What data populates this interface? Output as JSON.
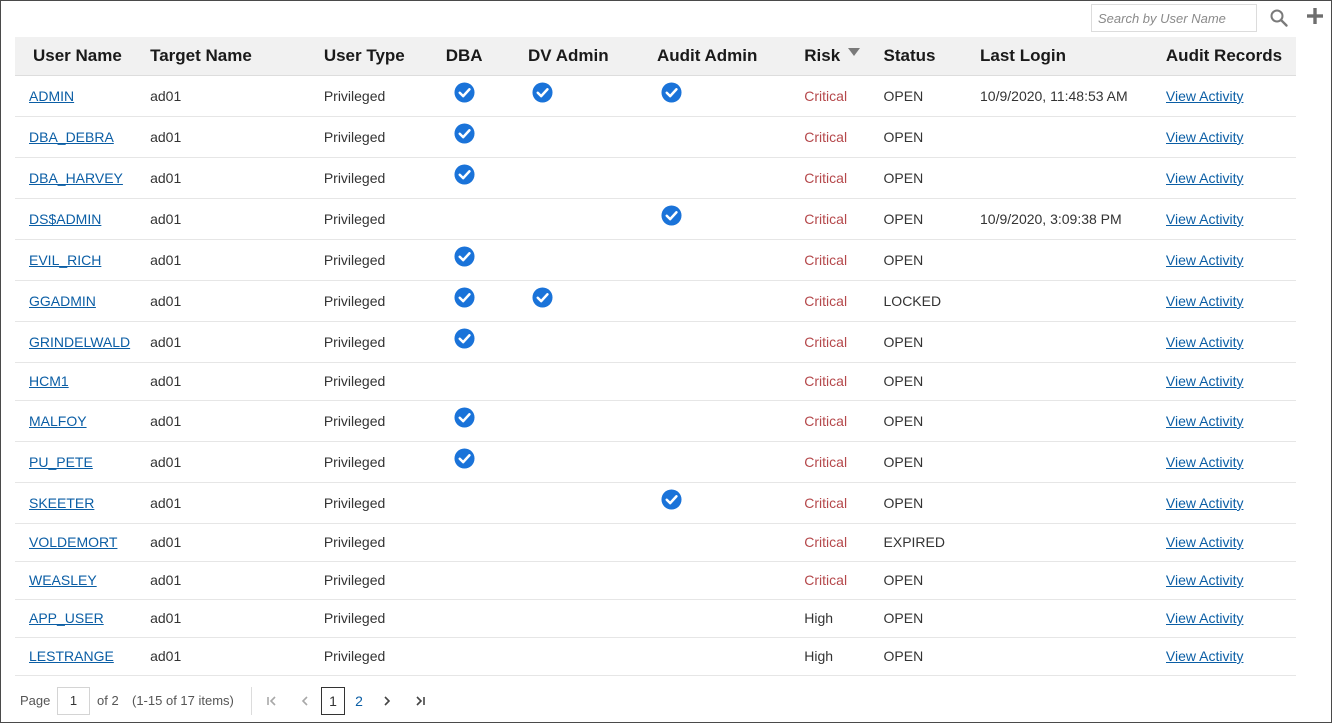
{
  "toolbar": {
    "search_placeholder": "Search by User Name",
    "search_icon": "search-icon",
    "add_icon": "plus-icon"
  },
  "colors": {
    "link": "#0b5ea5",
    "check": "#1a73d9",
    "critical": "#b5484b",
    "header_bg": "#f1f1f1"
  },
  "table": {
    "columns": [
      "User Name",
      "Target Name",
      "User Type",
      "DBA",
      "DV Admin",
      "Audit Admin",
      "Risk",
      "Status",
      "Last Login",
      "Audit Records"
    ],
    "sorted_column": "Risk",
    "sort_direction": "descending",
    "rows": [
      {
        "user": "ADMIN",
        "target": "ad01",
        "type": "Privileged",
        "dba": true,
        "dv_admin": true,
        "audit_admin": true,
        "risk": "Critical",
        "status": "OPEN",
        "last_login": "10/9/2020, 11:48:53 AM",
        "audit": "View Activity"
      },
      {
        "user": "DBA_DEBRA",
        "target": "ad01",
        "type": "Privileged",
        "dba": true,
        "dv_admin": false,
        "audit_admin": false,
        "risk": "Critical",
        "status": "OPEN",
        "last_login": "",
        "audit": "View Activity"
      },
      {
        "user": "DBA_HARVEY",
        "target": "ad01",
        "type": "Privileged",
        "dba": true,
        "dv_admin": false,
        "audit_admin": false,
        "risk": "Critical",
        "status": "OPEN",
        "last_login": "",
        "audit": "View Activity"
      },
      {
        "user": "DS$ADMIN",
        "target": "ad01",
        "type": "Privileged",
        "dba": false,
        "dv_admin": false,
        "audit_admin": true,
        "risk": "Critical",
        "status": "OPEN",
        "last_login": "10/9/2020, 3:09:38 PM",
        "audit": "View Activity"
      },
      {
        "user": "EVIL_RICH",
        "target": "ad01",
        "type": "Privileged",
        "dba": true,
        "dv_admin": false,
        "audit_admin": false,
        "risk": "Critical",
        "status": "OPEN",
        "last_login": "",
        "audit": "View Activity"
      },
      {
        "user": "GGADMIN",
        "target": "ad01",
        "type": "Privileged",
        "dba": true,
        "dv_admin": true,
        "audit_admin": false,
        "risk": "Critical",
        "status": "LOCKED",
        "last_login": "",
        "audit": "View Activity"
      },
      {
        "user": "GRINDELWALD",
        "target": "ad01",
        "type": "Privileged",
        "dba": true,
        "dv_admin": false,
        "audit_admin": false,
        "risk": "Critical",
        "status": "OPEN",
        "last_login": "",
        "audit": "View Activity"
      },
      {
        "user": "HCM1",
        "target": "ad01",
        "type": "Privileged",
        "dba": false,
        "dv_admin": false,
        "audit_admin": false,
        "risk": "Critical",
        "status": "OPEN",
        "last_login": "",
        "audit": "View Activity"
      },
      {
        "user": "MALFOY",
        "target": "ad01",
        "type": "Privileged",
        "dba": true,
        "dv_admin": false,
        "audit_admin": false,
        "risk": "Critical",
        "status": "OPEN",
        "last_login": "",
        "audit": "View Activity"
      },
      {
        "user": "PU_PETE",
        "target": "ad01",
        "type": "Privileged",
        "dba": true,
        "dv_admin": false,
        "audit_admin": false,
        "risk": "Critical",
        "status": "OPEN",
        "last_login": "",
        "audit": "View Activity"
      },
      {
        "user": "SKEETER",
        "target": "ad01",
        "type": "Privileged",
        "dba": false,
        "dv_admin": false,
        "audit_admin": true,
        "risk": "Critical",
        "status": "OPEN",
        "last_login": "",
        "audit": "View Activity"
      },
      {
        "user": "VOLDEMORT",
        "target": "ad01",
        "type": "Privileged",
        "dba": false,
        "dv_admin": false,
        "audit_admin": false,
        "risk": "Critical",
        "status": "EXPIRED",
        "last_login": "",
        "audit": "View Activity"
      },
      {
        "user": "WEASLEY",
        "target": "ad01",
        "type": "Privileged",
        "dba": false,
        "dv_admin": false,
        "audit_admin": false,
        "risk": "Critical",
        "status": "OPEN",
        "last_login": "",
        "audit": "View Activity"
      },
      {
        "user": "APP_USER",
        "target": "ad01",
        "type": "Privileged",
        "dba": false,
        "dv_admin": false,
        "audit_admin": false,
        "risk": "High",
        "status": "OPEN",
        "last_login": "",
        "audit": "View Activity"
      },
      {
        "user": "LESTRANGE",
        "target": "ad01",
        "type": "Privileged",
        "dba": false,
        "dv_admin": false,
        "audit_admin": false,
        "risk": "High",
        "status": "OPEN",
        "last_login": "",
        "audit": "View Activity"
      }
    ]
  },
  "pager": {
    "page_label": "Page",
    "current_page": "1",
    "of_label": "of 2",
    "items_label": "(1-15 of 17 items)",
    "pages": [
      "1",
      "2"
    ],
    "first_icon": "first-page-icon",
    "prev_icon": "previous-page-icon",
    "next_icon": "next-page-icon",
    "last_icon": "last-page-icon"
  }
}
